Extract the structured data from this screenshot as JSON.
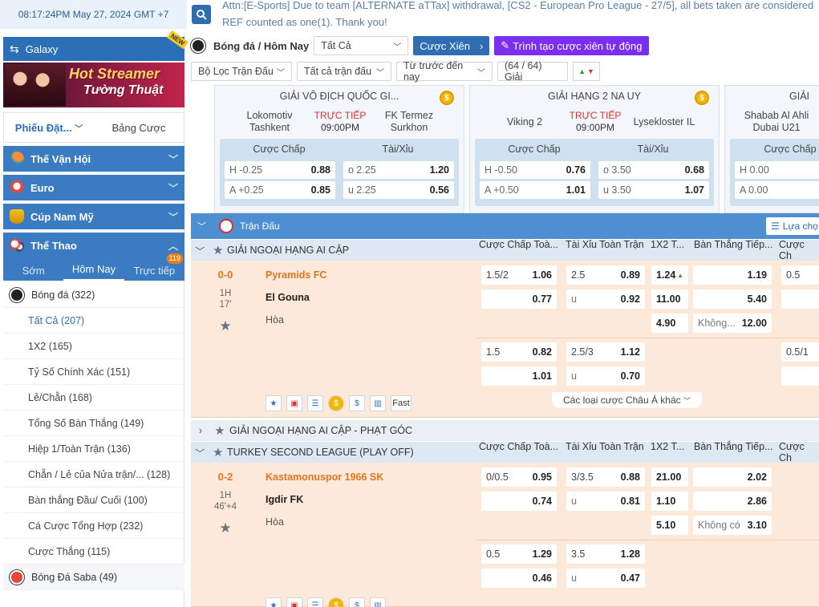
{
  "header": {
    "clock": "08:17:24PM May 27, 2024 GMT +7",
    "marquee": "Attn:[E-Sports] Due to team [ALTERNATE aTTax] withdrawal, [CS2 - European Pro League - 27/5], all bets taken are considered REF counted as one(1). Thank you!"
  },
  "sidebar": {
    "galaxy": "Galaxy",
    "new_badge": "NEW",
    "banner_line1": "Hot Streamer",
    "banner_line2": "Tường Thuật",
    "bet_tabs": [
      "Phiếu Đặt...",
      "Bảng Cược"
    ],
    "categories": [
      "Thế Vận Hội",
      "Euro",
      "Cúp Nam Mỹ",
      "Thể Thao"
    ],
    "sport_tabs": [
      "Sớm",
      "Hôm Nay",
      "Trực tiếp"
    ],
    "live_badge": "119",
    "sports": [
      {
        "label": "Bóng đá",
        "count": "(322)"
      },
      {
        "label": "Tất Cả",
        "count": "(207)"
      },
      {
        "label": "1X2",
        "count": "(165)"
      },
      {
        "label": "Tỷ Số Chính Xác",
        "count": "(151)"
      },
      {
        "label": "Lẻ/Chẵn",
        "count": "(168)"
      },
      {
        "label": "Tổng Số Bàn Thắng",
        "count": "(149)"
      },
      {
        "label": "Hiệp 1/Toàn Trận",
        "count": "(136)"
      },
      {
        "label": "Chẵn / Lẻ của Nửa trận/...",
        "count": "(128)"
      },
      {
        "label": "Bàn thắng Đầu/ Cuối",
        "count": "(100)"
      },
      {
        "label": "Cá Cược Tổng Hợp",
        "count": "(232)"
      },
      {
        "label": "Cược Thắng",
        "count": "(115)"
      },
      {
        "label": "Bóng Đá Saba",
        "count": "(49)"
      }
    ]
  },
  "filters": {
    "title": "Bóng đá / Hôm Nay",
    "all": "Tất Cả",
    "xien": "Cược Xiên",
    "auto": "Trình tạo cược xiên tự động",
    "match_filter": "Bộ Lọc Trận Đấu",
    "all_matches": "Tất cả trận đấu",
    "from_now": "Từ trước đến nay",
    "leagues": "(64 / 64) Giải"
  },
  "cards": [
    {
      "league": "GIẢI VÔ ĐỊCH QUỐC GI...",
      "home": "Lokomotiv Tashkent",
      "away": "FK Termez Surkhon",
      "live": "TRỰC TIẾP",
      "time": "09:00PM",
      "hcap_label": "Cược Chấp",
      "ou_label": "Tài/Xỉu",
      "h_k": "H -0.25",
      "h_v": "0.88",
      "a_k": "A +0.25",
      "a_v": "0.85",
      "o_k": "o 2.25",
      "o_v": "1.20",
      "u_k": "u 2.25",
      "u_v": "0.56"
    },
    {
      "league": "GIẢI HẠNG 2 NA UY",
      "home": "Viking 2",
      "away": "Lyseklost​er IL",
      "live": "TRỰC TIẾP",
      "time": "09:00PM",
      "hcap_label": "Cược Chấp",
      "ou_label": "Tài/Xỉu",
      "h_k": "H -0.50",
      "h_v": "0.76",
      "a_k": "A +0.50",
      "a_v": "1.01",
      "o_k": "o 3.50",
      "o_v": "0.68",
      "u_k": "u 3.50",
      "u_v": "1.07"
    },
    {
      "league": "GIẢI",
      "home": "Shabab Al Ahli Dubai U21",
      "hcap_label": "Cược Chấp",
      "h_k": "H 0.00",
      "a_k": "A 0.00"
    }
  ],
  "table": {
    "header": "Trận Đấu",
    "choose": "Lựa chọ",
    "cols": [
      "Cược Chấp Toà...",
      "Tài Xỉu Toàn Trận",
      "1X2 T...",
      "Bàn Thắng Tiếp...",
      "Cược Ch"
    ],
    "league1": "GIẢI NGOẠI HẠNG AI CẬP",
    "league2": "GIẢI NGOẠI HẠNG AI CẬP - PHẠT GÓC",
    "league3": "TURKEY SECOND LEAGUE (PLAY OFF)",
    "match1": {
      "score": "0-0",
      "half": "1H",
      "minute": "17'",
      "home": "Pyramids FC",
      "away": "El Gouna",
      "draw": "Hòa",
      "r1": {
        "hc_k": "1.5/2",
        "hc_v": "1.06",
        "ou_k": "2.5",
        "ou_v": "0.89",
        "x12": "1.24",
        "next": "1.19",
        "cc": "0.5"
      },
      "r2": {
        "hc_v": "0.77",
        "ou_k": "u",
        "ou_v": "0.92",
        "x12": "11.00",
        "next": "5.40"
      },
      "r3": {
        "x12": "4.90",
        "next_k": "Không...",
        "next_v": "12.00"
      },
      "r4": {
        "hc_k": "1.5",
        "hc_v": "0.82",
        "ou_k": "2.5/3",
        "ou_v": "1.12",
        "cc": "0.5/1"
      },
      "r5": {
        "hc_v": "1.01",
        "ou_k": "u",
        "ou_v": "0.70"
      },
      "fast": "Fast",
      "more": "Các loại cược Châu Á khác"
    },
    "match2": {
      "score": "0-2",
      "half": "1H",
      "minute": "46'+4",
      "home": "Kastamonuspor 1966 SK",
      "away": "Igdir FK",
      "draw": "Hòa",
      "r1": {
        "hc_k": "0/0.5",
        "hc_v": "0.95",
        "ou_k": "3/3.5",
        "ou_v": "0.88",
        "x12": "21.00",
        "next": "2.02"
      },
      "r2": {
        "hc_v": "0.74",
        "ou_k": "u",
        "ou_v": "0.81",
        "x12": "1.10",
        "next": "2.86"
      },
      "r3": {
        "x12": "5.10",
        "next_k": "Không có",
        "next_v": "3.10"
      },
      "r4": {
        "hc_k": "0.5",
        "hc_v": "1.29",
        "ou_k": "3.5",
        "ou_v": "1.28"
      },
      "r5": {
        "hc_v": "0.46",
        "ou_k": "u",
        "ou_v": "0.47"
      }
    }
  }
}
